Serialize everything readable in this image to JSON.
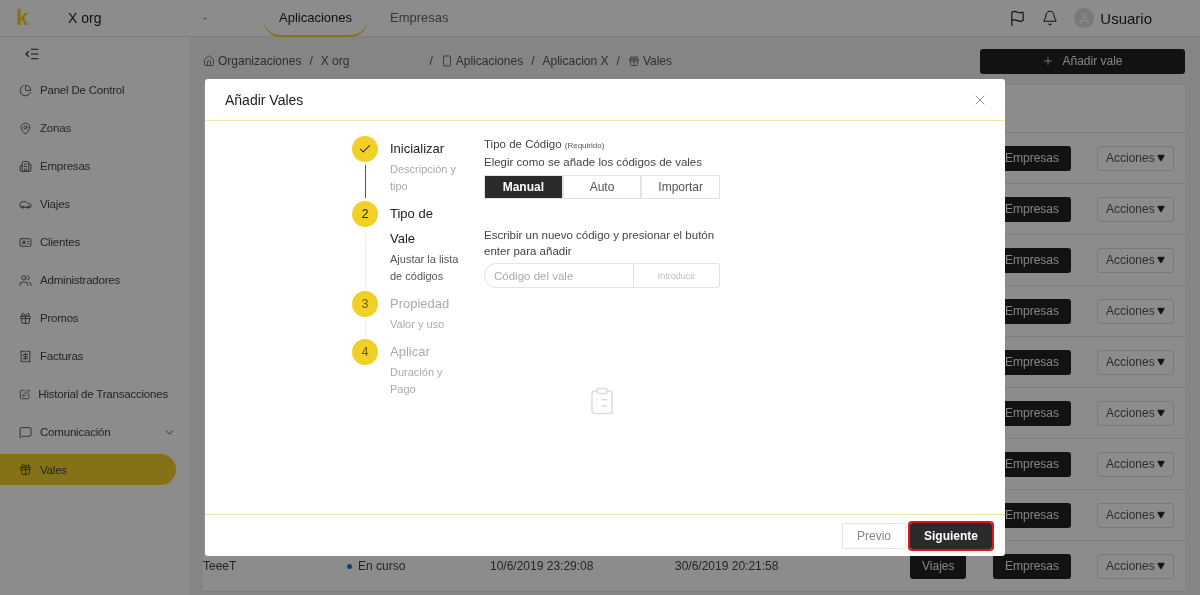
{
  "header": {
    "logo": "k",
    "org": "X org",
    "separator": "-",
    "tabs": [
      {
        "label": "Aplicaciones",
        "selected": true
      },
      {
        "label": "Empresas",
        "selected": false
      }
    ],
    "user": "Usuario"
  },
  "sidebar": {
    "items": [
      {
        "label": "Panel De Control",
        "kind": "link",
        "selected": false
      },
      {
        "label": "Zonas",
        "kind": "link",
        "selected": false
      },
      {
        "label": "Empresas",
        "kind": "link",
        "selected": false
      },
      {
        "label": "Viajes",
        "kind": "link",
        "selected": false
      },
      {
        "label": "Clientes",
        "kind": "link",
        "selected": false
      },
      {
        "label": "Administradores",
        "kind": "link",
        "selected": false
      },
      {
        "label": "Promos",
        "kind": "link",
        "selected": false
      },
      {
        "label": "Facturas",
        "kind": "link",
        "selected": false
      },
      {
        "label": "Historial de Transacciones",
        "kind": "link",
        "selected": false
      },
      {
        "label": "Comunicación",
        "kind": "group",
        "selected": false
      },
      {
        "label": "Vales",
        "kind": "link",
        "selected": true
      }
    ]
  },
  "breadcrumb": [
    {
      "label": "Organizaciones",
      "separator": "/"
    },
    {
      "label": "X org",
      "separator": "/"
    },
    {
      "label": "Aplicaciones",
      "separator": "/"
    },
    {
      "label": "Aplicacion X",
      "separator": "/"
    },
    {
      "label": "Vales"
    }
  ],
  "add_button": {
    "label": "Añadir vale"
  },
  "table": {
    "rows": [
      {
        "buttons": [
          "Empresas"
        ],
        "action": "Acciones"
      },
      {
        "buttons": [
          "Empresas"
        ],
        "action": "Acciones"
      },
      {
        "buttons": [
          "Empresas"
        ],
        "action": "Acciones"
      },
      {
        "buttons": [
          "Empresas"
        ],
        "action": "Acciones"
      },
      {
        "buttons": [
          "Empresas"
        ],
        "action": "Acciones"
      },
      {
        "buttons": [
          "Empresas"
        ],
        "action": "Acciones"
      },
      {
        "buttons": [
          "Empresas"
        ],
        "action": "Acciones"
      },
      {
        "buttons": [
          "Empresas"
        ],
        "action": "Acciones"
      },
      {
        "name": "TeeeT",
        "status": "En curso",
        "start": "10/6/2019 23:29:08",
        "end": "30/6/2019 20:21:58",
        "buttons": [
          "Viajes",
          "Empresas"
        ],
        "action": "Acciones"
      }
    ]
  },
  "modal": {
    "title": "Añadir Vales",
    "steps": [
      {
        "label": "Inicializar",
        "description": "Descripción y tipo",
        "completed": true,
        "active": false
      },
      {
        "label": "Tipo de Vale",
        "number": "2",
        "description": "Ajustar la lista de códigos",
        "completed": false,
        "active": true
      },
      {
        "label": "Propiedad",
        "number": "3",
        "description": "Valor y uso",
        "completed": false,
        "active": false
      },
      {
        "label": "Aplicar",
        "number": "4",
        "description": "Duración y Pago",
        "completed": false,
        "active": false
      }
    ],
    "form": {
      "label": "Tipo de Código",
      "required": "(Requirido)",
      "hint": "Elegir como se añade los códigos de vales",
      "segments": [
        {
          "label": "Manual",
          "selected": true
        },
        {
          "label": "Auto",
          "selected": false
        },
        {
          "label": "Importar",
          "selected": false
        }
      ],
      "instruction": "Escribir un nuevo código y presionar el butón enter para añadir",
      "input": {
        "placeholder": "Código del vale",
        "addon": "Introducir"
      }
    },
    "footer": [
      {
        "label": "Previo",
        "kind": "secondary",
        "highlighted": false
      },
      {
        "label": "Siguiente",
        "kind": "primary",
        "highlighted": true
      }
    ]
  }
}
